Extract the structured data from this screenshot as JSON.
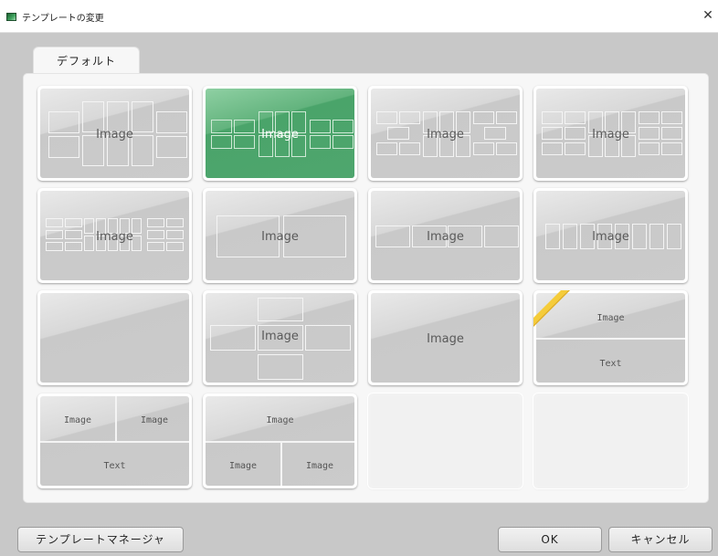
{
  "window": {
    "title": "テンプレートの変更",
    "close_glyph": "✕"
  },
  "tabs": [
    {
      "label": "デフォルト",
      "active": true
    }
  ],
  "templates": {
    "image_label": "Image",
    "text_label": "Text",
    "selected_index": 1
  },
  "footer": {
    "manager_button": "テンプレートマネージャ",
    "ok_button": "OK",
    "cancel_button": "キャンセル"
  },
  "colors": {
    "selected_accent": "#4fa66e",
    "corner_marker": "#f5cc3a"
  }
}
